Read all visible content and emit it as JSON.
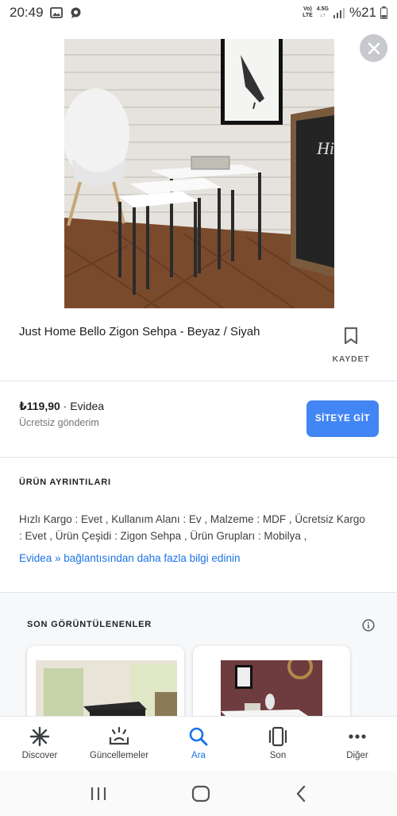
{
  "status_bar": {
    "time": "20:49",
    "network_top": "Vo)",
    "network_bottom": "LTE",
    "net_gen": "4.5G",
    "battery": "%21"
  },
  "product": {
    "title": "Just Home Bello Zigon Sehpa - Beyaz / Siyah",
    "save_label": "KAYDET",
    "price": "₺119,90",
    "seller_sep": " · ",
    "seller": "Evidea",
    "shipping": "Ücretsiz gönderim",
    "site_button": "SİTEYE GİT"
  },
  "details": {
    "heading": "ÜRÜN AYRINTILARI",
    "text": "Hızlı Kargo : Evet , Kullanım Alanı : Ev , Malzeme : MDF , Ücretsiz Kargo : Evet , Ürün Çeşidi : Zigon Sehpa , Ürün Grupları : Mobilya ,",
    "link": "Evidea » bağlantısından daha fazla bilgi edinin"
  },
  "recent": {
    "heading": "SON GÖRÜNTÜLENENLER"
  },
  "bottom_nav": [
    {
      "label": "Discover",
      "icon": "asterisk-icon"
    },
    {
      "label": "Güncellemeler",
      "icon": "updates-icon"
    },
    {
      "label": "Ara",
      "icon": "search-icon"
    },
    {
      "label": "Son",
      "icon": "recent-cards-icon"
    },
    {
      "label": "Diğer",
      "icon": "more-dots-icon"
    }
  ],
  "colors": {
    "accent": "#1a73e8",
    "button_blue": "#4285f4"
  }
}
